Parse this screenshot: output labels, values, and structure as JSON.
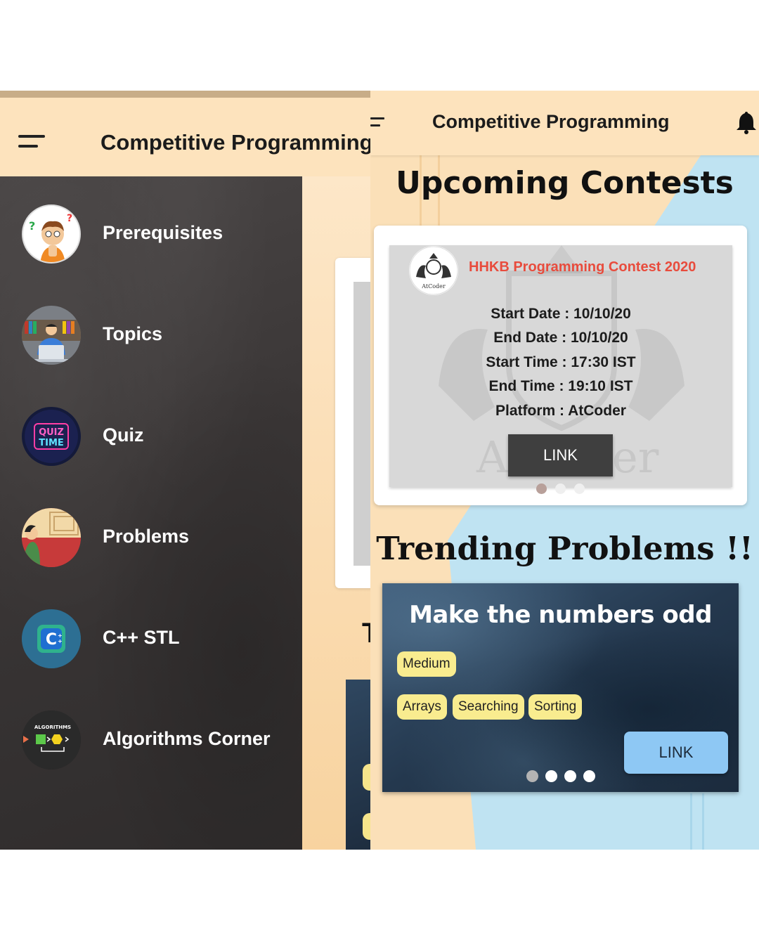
{
  "left_screen": {
    "app_title": "Competitive Programming",
    "drawer_items": [
      {
        "label": "Prerequisites",
        "icon": "prerequisites-icon"
      },
      {
        "label": "Topics",
        "icon": "topics-icon"
      },
      {
        "label": "Quiz",
        "icon": "quiz-icon"
      },
      {
        "label": "Problems",
        "icon": "problems-icon"
      },
      {
        "label": "C++ STL",
        "icon": "cpp-stl-icon"
      },
      {
        "label": "Algorithms Corner",
        "icon": "algorithms-icon"
      }
    ],
    "quiz_icon_text": [
      "QUIZ",
      "TIME"
    ],
    "algo_icon_text": "ALGORITHMS"
  },
  "right_screen": {
    "app_title": "Competitive Programming",
    "upcoming_heading": "Upcoming Contests",
    "contest": {
      "name": "HHKB Programming Contest 2020",
      "logo_text": "AtCoder",
      "watermark": "AtCoder",
      "lines": [
        "Start Date : 10/10/20",
        "End Date : 10/10/20",
        "Start Time : 17:30 IST",
        "End Time : 19:10 IST",
        "Platform : AtCoder"
      ],
      "link_label": "LINK",
      "carousel_active": 0,
      "carousel_count": 3
    },
    "trending_heading": "Trending Problems !!",
    "problem": {
      "title": "Make the numbers odd",
      "difficulty": "Medium",
      "tags": [
        "Arrays",
        "Searching",
        "Sorting"
      ],
      "link_label": "LINK",
      "carousel_active": 0,
      "carousel_count": 4
    }
  },
  "colors": {
    "appbar": "#fde3bd",
    "drawer": "#3a3636",
    "contest_name": "#e84c3d",
    "tag": "#f9ec8f",
    "link_blue": "#8ec8f4",
    "link_dark": "#3f3f3f",
    "bg_blue": "#bfe3f2"
  }
}
